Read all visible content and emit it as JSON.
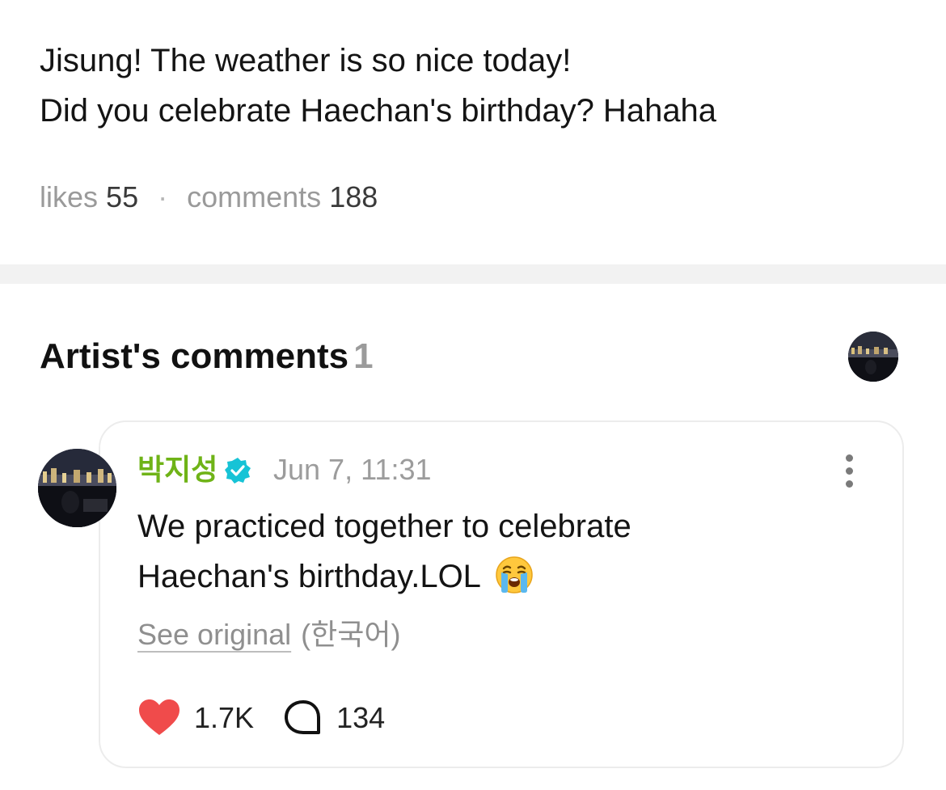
{
  "post": {
    "lines": [
      "Jisung! The weather is so nice today!",
      "Did you celebrate Haechan's birthday? Hahaha"
    ],
    "stats": {
      "likes_label": "likes",
      "likes_value": "55",
      "separator": "·",
      "comments_label": "comments",
      "comments_value": "188"
    }
  },
  "artist_comments": {
    "title": "Artist's comments",
    "count": "1",
    "avatar_icon": "user-avatar-icon",
    "comments": [
      {
        "author": "박지성",
        "verified": true,
        "verified_icon": "verified-badge-icon",
        "time": "Jun 7, 11:31",
        "text_lines": [
          "We practiced together to celebrate",
          "Haechan's birthday.LOL"
        ],
        "emoji": "crying-face-icon",
        "see_original_label": "See original",
        "original_language": "(한국어)",
        "likes": "1.7K",
        "replies": "134",
        "more_icon": "more-options-icon"
      }
    ]
  },
  "colors": {
    "author": "#6fb317",
    "verified": "#17c3d6",
    "heart": "#f04b4b",
    "muted": "#9a9a9a",
    "divider": "#f2f2f2"
  }
}
